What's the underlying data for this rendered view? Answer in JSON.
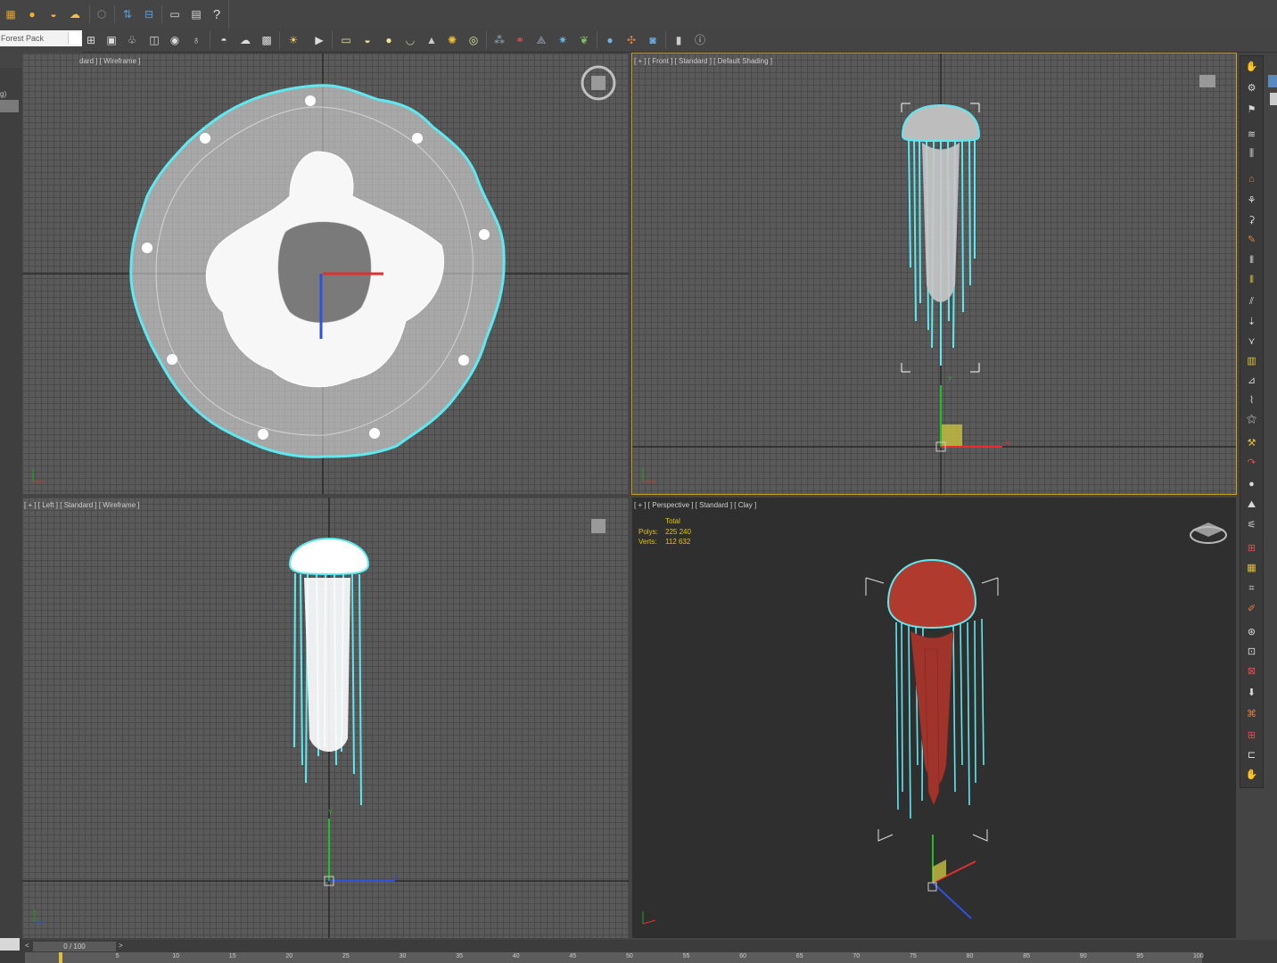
{
  "toolbar_top": {
    "icons": [
      "grid-icon",
      "drop-icon",
      "layers-icon",
      "cloud-icon",
      "cube-icon",
      "link-icon",
      "chain-icon",
      "render-frame-icon",
      "render-icon",
      "help-icon"
    ],
    "help_label": "?"
  },
  "toolbar_second": {
    "dropdown_value": "Forest Pack",
    "icons": [
      "select-icon",
      "region-icon",
      "tree-icon",
      "object-icon",
      "eye-icon",
      "light-icon",
      "teapot-icon",
      "cloud-icon",
      "render-icon",
      "spotlight-icon",
      "camera-icon",
      "box-icon",
      "sphere-icon",
      "torus-icon",
      "teapot-icon",
      "cone-icon",
      "sun-icon",
      "globe-icon",
      "particles-icon",
      "molecule-icon",
      "pyramid-icon",
      "gem-icon",
      "plant-icon",
      "material-icon",
      "palette-icon",
      "environment-icon",
      "settings-icon",
      "info-icon"
    ]
  },
  "left_tabs": {
    "icons": [
      "tree-icon",
      "hammer-icon",
      "list-icon"
    ],
    "label": "g)"
  },
  "viewports": {
    "top": {
      "label": "[ + ] [ Top ] [ Standard ] [ Wireframe ]",
      "visible_label": "dard ] [ Wireframe ]"
    },
    "front": {
      "label": "[ + ] [ Front ] [ Standard ] [ Default Shading ]"
    },
    "left": {
      "label": "[ + ] [ Left ] [ Standard ] [ Wireframe ]"
    },
    "perspective": {
      "label": "[ + ] [ Perspective ] [ Standard ] [ Clay ]",
      "stats": {
        "header": "Total",
        "polys_label": "Polys:",
        "polys": "225 240",
        "verts_label": "Verts:",
        "verts": "112 632"
      }
    }
  },
  "gizmo": {
    "y_label": "Y",
    "x_label": "X",
    "z_label": "Z"
  },
  "timeline": {
    "slider_label": "0 / 100",
    "ticks": [
      "0",
      "5",
      "10",
      "15",
      "20",
      "25",
      "30",
      "35",
      "40",
      "45",
      "50",
      "55",
      "60",
      "65",
      "70",
      "75",
      "80",
      "85",
      "90",
      "95",
      "100"
    ]
  },
  "colors": {
    "selection": "#5ee8f0",
    "jelly_clay": "#b03a2e",
    "active_border": "#c8a020",
    "stats_text": "#e6c800"
  }
}
